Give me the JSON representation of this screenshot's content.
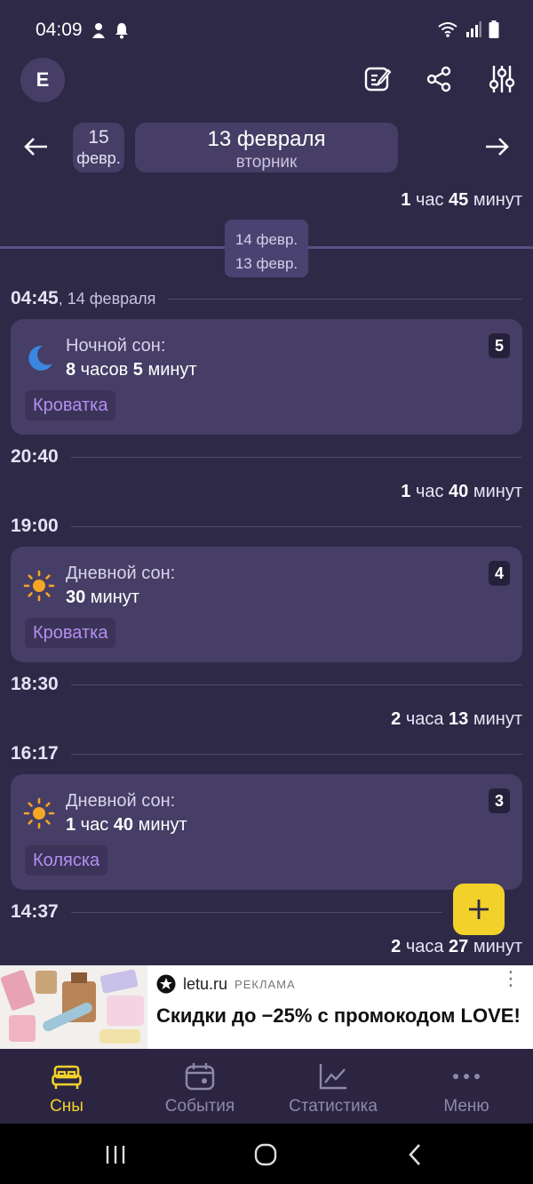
{
  "status_bar": {
    "time": "04:09"
  },
  "header": {
    "avatar_letter": "E"
  },
  "date_nav": {
    "prev_day": "15",
    "prev_month": "февр.",
    "current_date": "13 февраля",
    "current_weekday": "вторник"
  },
  "timeline": {
    "top_gap": {
      "num1": "1",
      "u1": "час",
      "num2": "45",
      "u2": "минут"
    },
    "day_chip": {
      "line1": "14 февр.",
      "line2": "13 февр."
    },
    "times": [
      {
        "time": "04:45",
        "sub": ", 14 февраля"
      },
      {
        "time": "20:40",
        "sub": ""
      },
      {
        "time": "19:00",
        "sub": ""
      },
      {
        "time": "18:30",
        "sub": ""
      },
      {
        "time": "16:17",
        "sub": ""
      },
      {
        "time": "14:37",
        "sub": ""
      }
    ],
    "gaps": [
      {
        "num1": "1",
        "u1": "час",
        "num2": "40",
        "u2": "минут"
      },
      {
        "num1": "2",
        "u1": "часа",
        "num2": "13",
        "u2": "минут"
      },
      {
        "num1": "2",
        "u1": "часа",
        "num2": "27",
        "u2": "минут"
      }
    ],
    "cards": [
      {
        "title": "Ночной сон:",
        "n1": "8",
        "u1": " часов ",
        "n2": "5",
        "u2": " минут",
        "tag": "Кроватка",
        "badge": "5",
        "icon": "moon-icon"
      },
      {
        "title": "Дневной сон:",
        "n1": "30",
        "u1": " минут",
        "n2": "",
        "u2": "",
        "tag": "Кроватка",
        "badge": "4",
        "icon": "sun-icon"
      },
      {
        "title": "Дневной сон:",
        "n1": "1",
        "u1": " час ",
        "n2": "40",
        "u2": " минут",
        "tag": "Коляска",
        "badge": "3",
        "icon": "sun-icon"
      }
    ]
  },
  "ad": {
    "brand": "letu.ru",
    "label": "РЕКЛАМА",
    "headline": "Скидки до −25% с промокодом LOVE!"
  },
  "bottom_nav": {
    "items": [
      {
        "label": "Сны",
        "icon": "bed-icon",
        "active": true
      },
      {
        "label": "События",
        "icon": "calendar-icon",
        "active": false
      },
      {
        "label": "Статистика",
        "icon": "chart-icon",
        "active": false
      },
      {
        "label": "Меню",
        "icon": "more-icon",
        "active": false
      }
    ]
  },
  "colors": {
    "background": "#2f2948",
    "card": "#463e66",
    "accent_yellow": "#f1d12a",
    "tag_text": "#b48ff0",
    "moon": "#3b86e0",
    "sun": "#f5a623"
  }
}
